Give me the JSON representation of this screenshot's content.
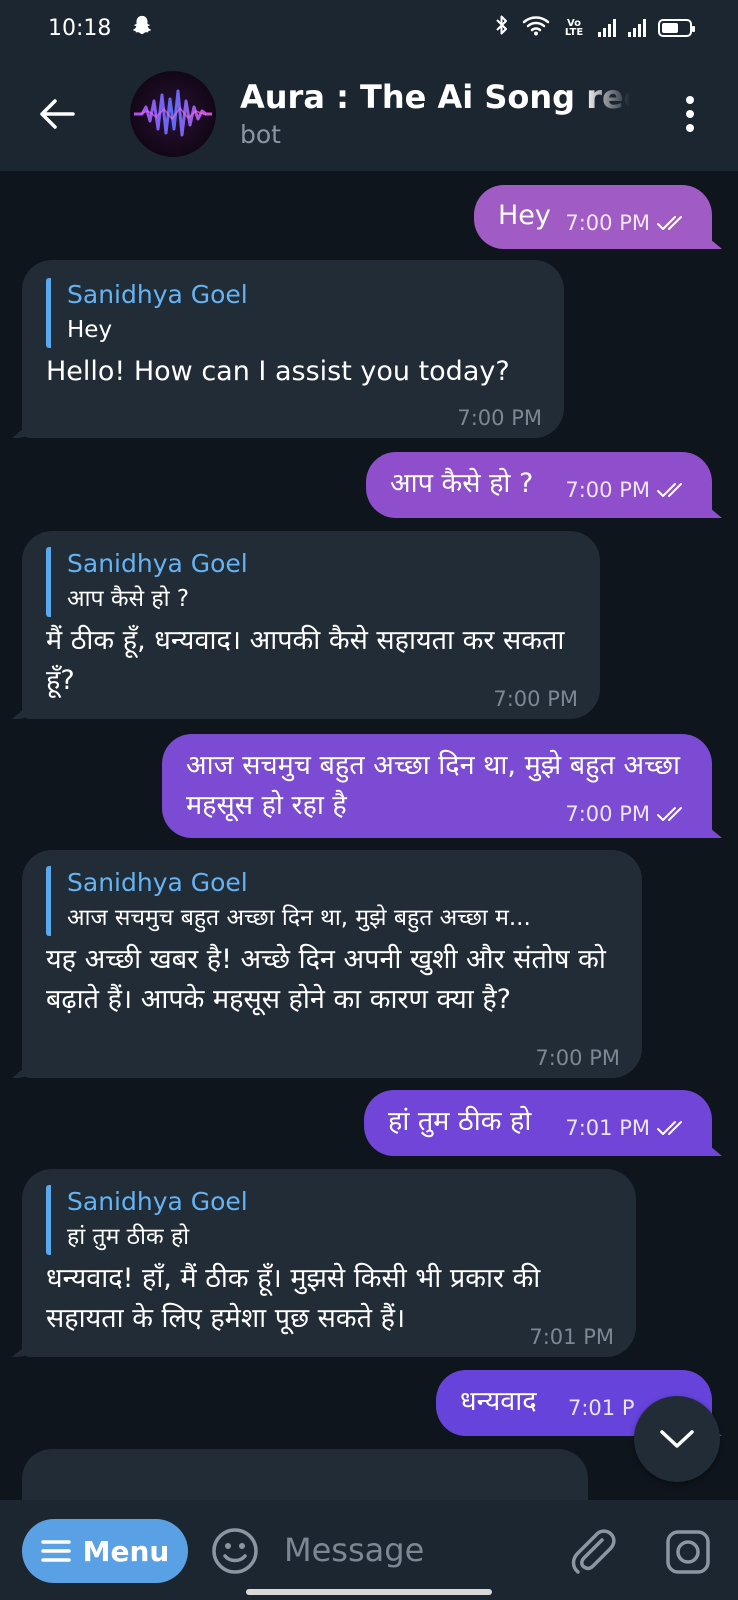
{
  "status_bar": {
    "time": "10:18",
    "volte_label": "Vo LTE",
    "notification_icon": "snapchat-ghost-icon",
    "icons": [
      "bluetooth-icon",
      "wifi-icon",
      "signal-icon",
      "signal-icon",
      "battery-icon"
    ]
  },
  "header": {
    "title": "Aura : The Ai Song recor",
    "subtitle": "bot",
    "back_icon": "arrow-left-icon",
    "more_icon": "more-vertical-icon"
  },
  "messages": [
    {
      "dir": "out",
      "text": "Hey",
      "time": "7:00 PM",
      "status": "read"
    },
    {
      "dir": "in",
      "reply_name": "Sanidhya Goel",
      "reply_text": "Hey",
      "text": "Hello! How can I assist you today?",
      "time": "7:00 PM"
    },
    {
      "dir": "out",
      "text": "आप कैसे हो ?",
      "time": "7:00 PM",
      "status": "read"
    },
    {
      "dir": "in",
      "reply_name": "Sanidhya Goel",
      "reply_text": "आप कैसे हो ?",
      "text": "मैं ठीक हूँ, धन्यवाद। आपकी कैसे सहायता कर सकता हूँ?",
      "time": "7:00 PM"
    },
    {
      "dir": "out",
      "text": "आज सचमुच बहुत अच्छा दिन था, मुझे बहुत अच्छा महसूस हो रहा है",
      "time": "7:00 PM",
      "status": "read"
    },
    {
      "dir": "in",
      "reply_name": "Sanidhya Goel",
      "reply_text": "आज सचमुच बहुत अच्छा दिन था, मुझे बहुत अच्छा म...",
      "text": "यह अच्छी खबर है! अच्छे दिन अपनी खुशी और संतोष को बढ़ाते हैं। आपके महसूस होने का कारण क्या है?",
      "time": "7:00 PM"
    },
    {
      "dir": "out",
      "text": "हां तुम ठीक हो",
      "time": "7:01 PM",
      "status": "read"
    },
    {
      "dir": "in",
      "reply_name": "Sanidhya Goel",
      "reply_text": "हां तुम ठीक हो",
      "text": "धन्यवाद! हाँ, मैं ठीक हूँ। मुझसे किसी भी प्रकार की सहायता के लिए हमेशा पूछ सकते हैं।",
      "time": "7:01 PM"
    },
    {
      "dir": "out",
      "text": "धन्यवाद",
      "time": "7:01 P",
      "status": "read"
    }
  ],
  "composer": {
    "menu_label": "Menu",
    "placeholder": "Message",
    "emoji_icon": "emoji-icon",
    "attach_icon": "paperclip-icon",
    "camera_icon": "camera-icon"
  },
  "scroll_icon": "chevron-down-icon",
  "colors": {
    "background": "#0f151c",
    "bar": "#1c2630",
    "incoming_bubble": "#222c36",
    "outgoing_bubble": "#8e52c8",
    "reply_accent": "#64b3f4",
    "menu_button": "#5aa0e4"
  }
}
